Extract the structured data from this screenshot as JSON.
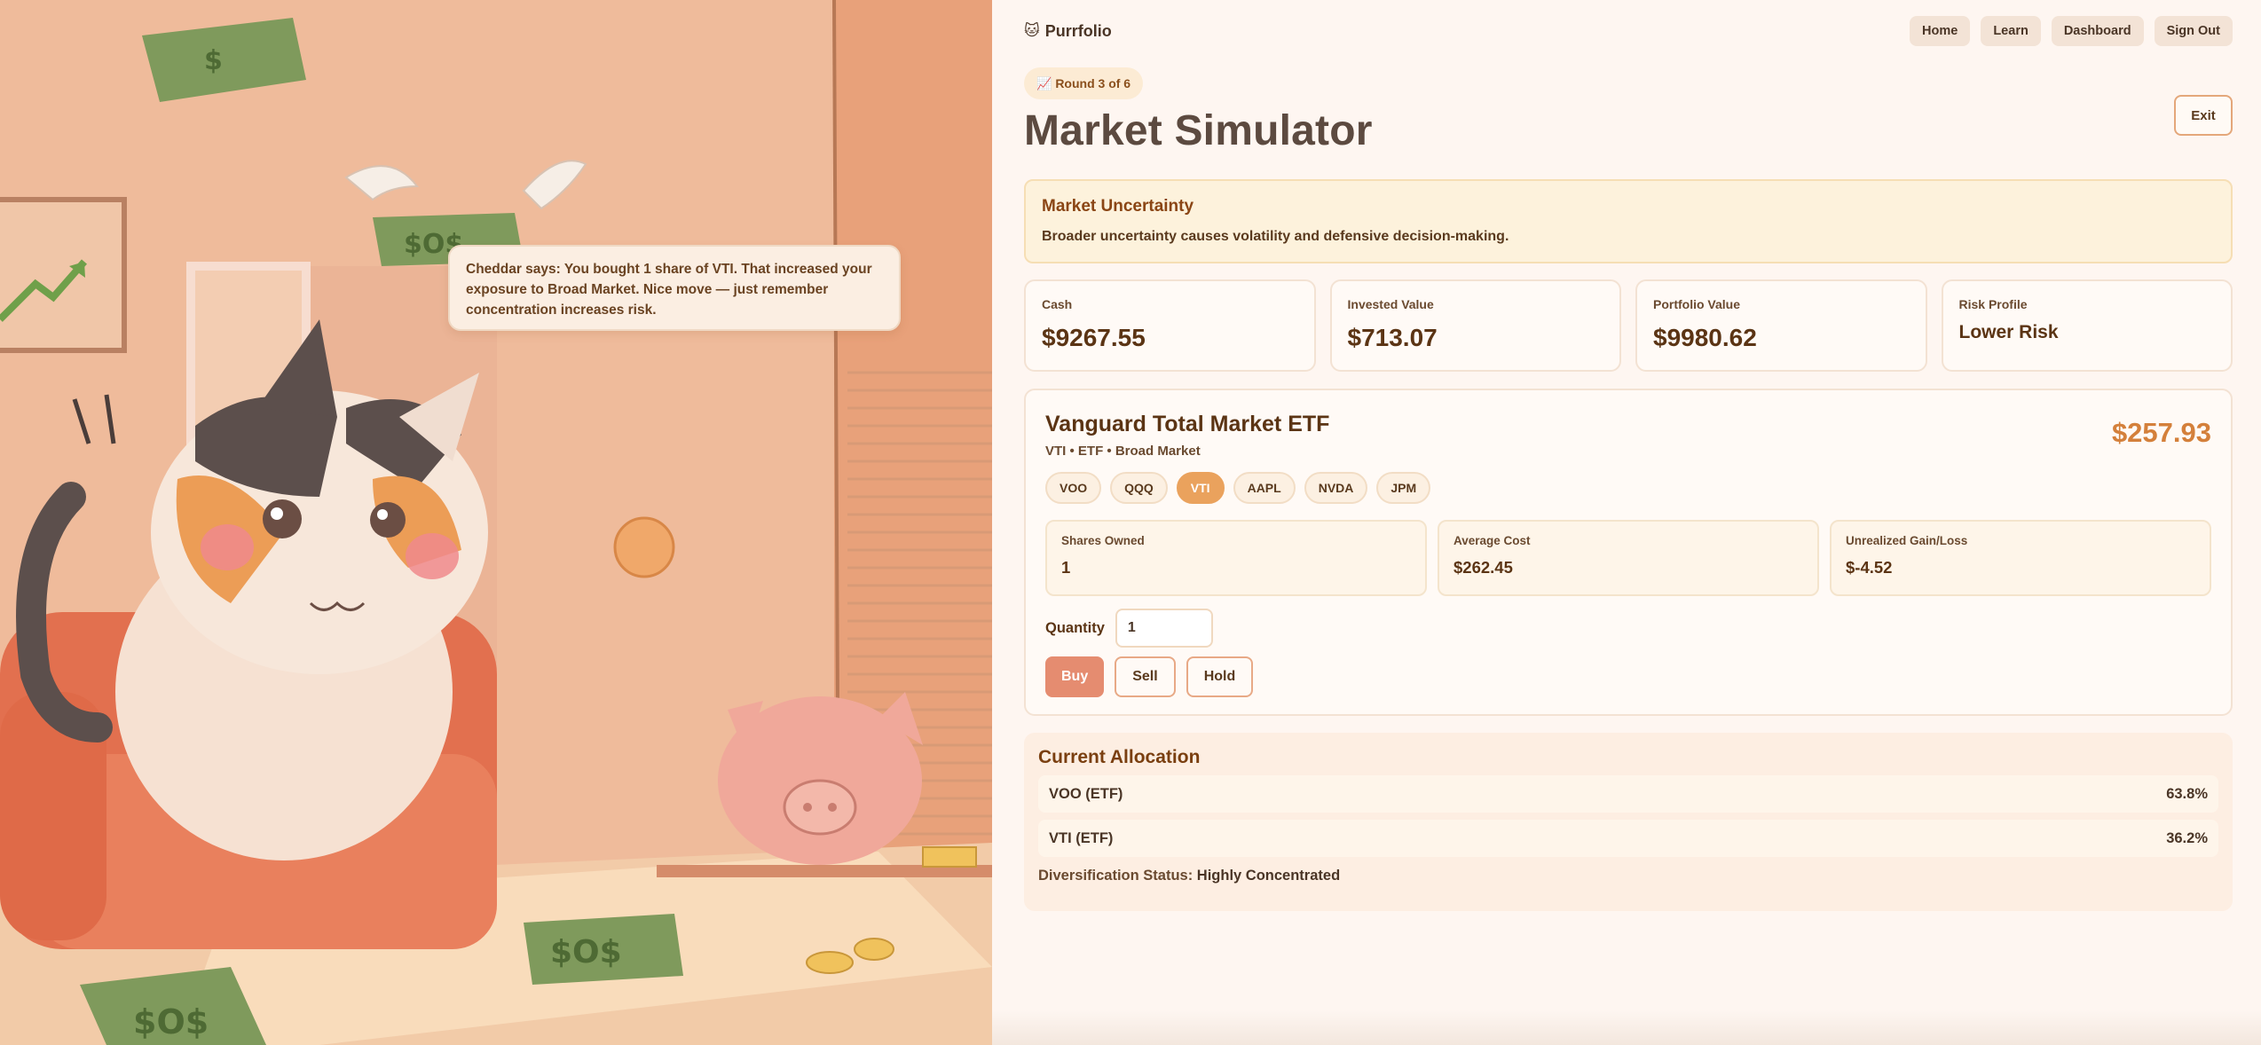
{
  "scene": {
    "speech": "Cheddar says: You bought 1 share of VTI. That increased your exposure to Broad Market. Nice move — just remember concentration increases risk."
  },
  "brand": {
    "name": "Purrfolio",
    "icon": "cat-face-icon"
  },
  "nav": [
    "Home",
    "Learn",
    "Dashboard",
    "Sign Out"
  ],
  "round_badge": "📈 Round 3 of 6",
  "page_title": "Market Simulator",
  "exit_label": "Exit",
  "alert": {
    "title": "Market Uncertainty",
    "description": "Broader uncertainty causes volatility and defensive decision-making."
  },
  "stats": [
    {
      "label": "Cash",
      "value": "$9267.55"
    },
    {
      "label": "Invested Value",
      "value": "$713.07"
    },
    {
      "label": "Portfolio Value",
      "value": "$9980.62"
    },
    {
      "label": "Risk Profile",
      "value": "Lower Risk"
    }
  ],
  "stock": {
    "name": "Vanguard Total Market ETF",
    "sub": "VTI • ETF • Broad Market",
    "price": "$257.93",
    "tickers": [
      "VOO",
      "QQQ",
      "VTI",
      "AAPL",
      "NVDA",
      "JPM"
    ],
    "selected": "VTI",
    "holdings": [
      {
        "label": "Shares Owned",
        "value": "1"
      },
      {
        "label": "Average Cost",
        "value": "$262.45"
      },
      {
        "label": "Unrealized Gain/Loss",
        "value": "$-4.52"
      }
    ],
    "quantity_label": "Quantity",
    "quantity_value": "1",
    "actions": [
      "Buy",
      "Sell",
      "Hold"
    ]
  },
  "allocation": {
    "title": "Current Allocation",
    "rows": [
      {
        "name": "VOO (ETF)",
        "pct": "63.8%"
      },
      {
        "name": "VTI (ETF)",
        "pct": "36.2%"
      }
    ],
    "status_label": "Diversification Status:",
    "status_value": "Highly Concentrated"
  },
  "colors": {
    "accent": "#eaa25d",
    "buy": "#e58c70",
    "price": "#d4803b"
  }
}
